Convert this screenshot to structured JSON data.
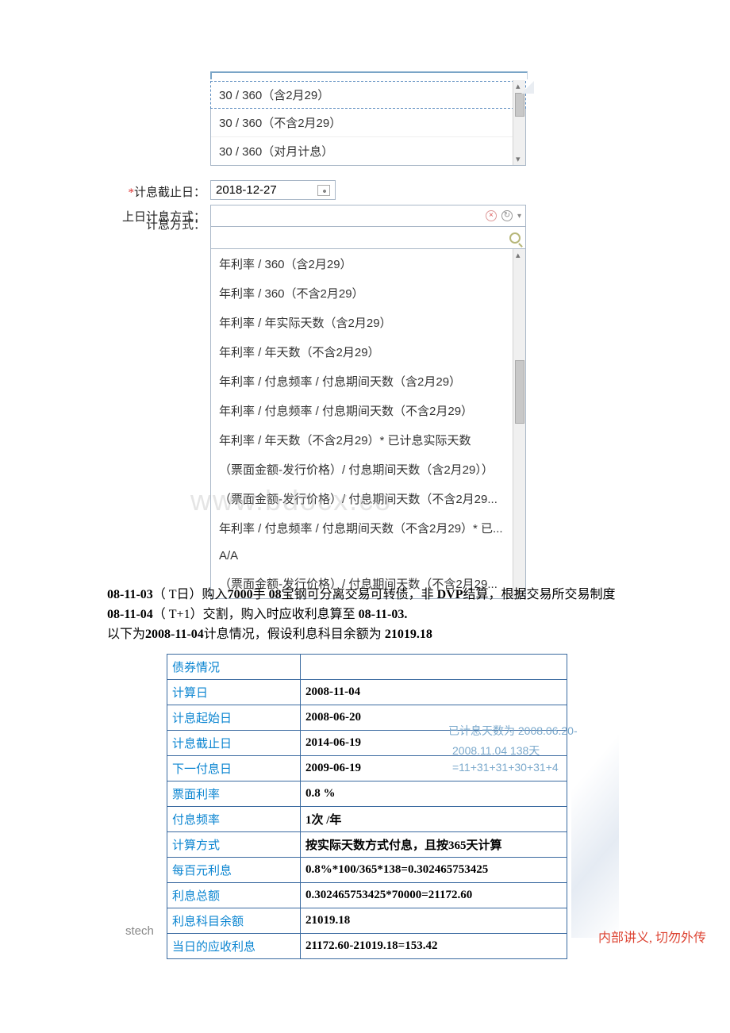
{
  "labels": {
    "interest_method": "计息方式：",
    "interest_end_date": "计息截止日：",
    "prev_day_method": "上日计息方式："
  },
  "required_marker": "*",
  "dropdown1": {
    "selected": "30 / 360（含2月29）",
    "items": [
      "30 / 360（不含2月29）",
      "30 / 360（对月计息）"
    ]
  },
  "interest_end_date_value": "2018-12-27",
  "dropdown2": {
    "search_placeholder": "",
    "items": [
      "年利率 / 360（含2月29）",
      "年利率 / 360（不含2月29）",
      "年利率 / 年实际天数（含2月29）",
      "年利率 / 年天数（不含2月29）",
      "年利率 / 付息频率 / 付息期间天数（含2月29）",
      "年利率 / 付息频率 / 付息期间天数（不含2月29）",
      "年利率 / 年天数（不含2月29）* 已计息实际天数",
      "（票面金额-发行价格）/ 付息期间天数（含2月29））",
      "（票面金额-发行价格）/ 付息期间天数（不含2月29...",
      "年利率 / 付息频率 / 付息期间天数（不含2月29）* 已...",
      "A/A",
      "（票面金额-发行价格）/ 付息期间天数（不含2月29..."
    ]
  },
  "paragraph": {
    "line1a": "08-11-03",
    "line1b": "（ T日）购入",
    "line1c": "7000",
    "line1d": "手 ",
    "line1e": "08",
    "line1f": "宝钢可分离交易可转债，非 ",
    "line1g": "DVP",
    "line1h": "结算，根据交易所交易制度 ",
    "line2a": "08-11-04",
    "line2b": "（ T+1）交割，购入时应收利息算至 ",
    "line2c": "08-11-03.",
    "line3a": "以下为",
    "line3b": "2008-11-04",
    "line3c": "计息情况，假设利息科目余额为 ",
    "line3d": "21019.18"
  },
  "bond_table": {
    "header": "债券情况",
    "rows": [
      {
        "k": "计算日",
        "v": "2008-11-04"
      },
      {
        "k": "计息起始日",
        "v": "2008-06-20"
      },
      {
        "k": "计息截止日",
        "v": "2014-06-19"
      },
      {
        "k": "下一付息日",
        "v": "2009-06-19"
      },
      {
        "k": "票面利率",
        "v": "0.8 %"
      },
      {
        "k": "付息频率",
        "v": "1次 /年"
      },
      {
        "k": "计算方式",
        "v": "按实际天数方式付息，且按365天计算"
      },
      {
        "k": "每百元利息",
        "v": "0.8%*100/365*138=0.302465753425"
      },
      {
        "k": "利息总额",
        "v": "0.302465753425*70000=21172.60"
      },
      {
        "k": "利息科目余额",
        "v": "21019.18"
      },
      {
        "k": "当日的应收利息",
        "v": "21172.60-21019.18=153.42"
      }
    ]
  },
  "annotations": {
    "a1": "已计息天数为 2008.06.20-",
    "a2": "2008.11.04     138天",
    "a3": "=11+31+31+30+31+4"
  },
  "watermark": "www.bdocx.co",
  "footer_left": "stech",
  "footer_right": "内部讲义, 切勿外传"
}
